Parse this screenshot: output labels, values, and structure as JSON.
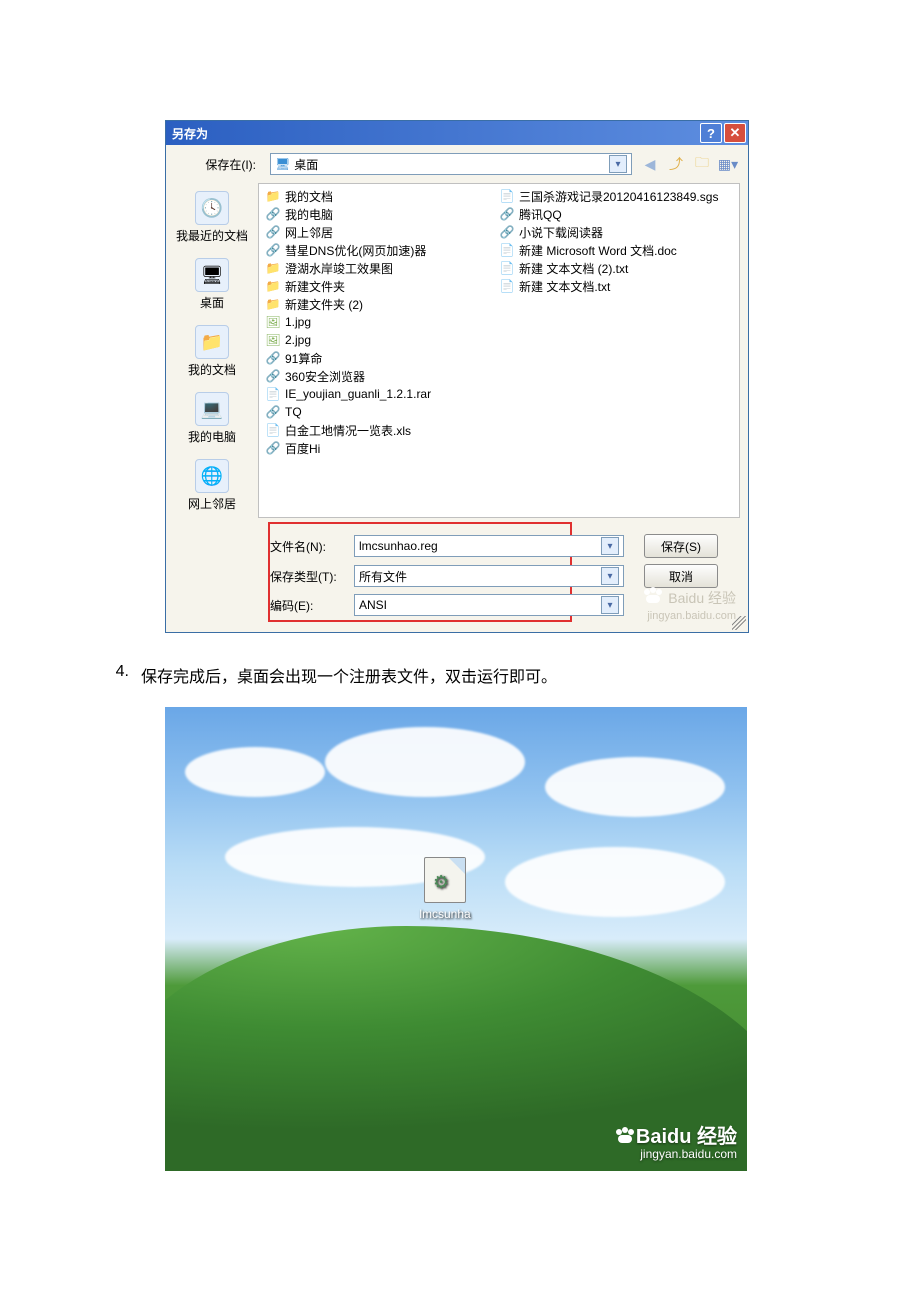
{
  "dialog": {
    "title": "另存为",
    "saveIn_label": "保存在(I):",
    "location": "桌面",
    "places": [
      {
        "label": "我最近的文档",
        "glyph": "🕓"
      },
      {
        "label": "桌面",
        "glyph": "🖥"
      },
      {
        "label": "我的文档",
        "glyph": "📁"
      },
      {
        "label": "我的电脑",
        "glyph": "💻"
      },
      {
        "label": "网上邻居",
        "glyph": "🌐"
      }
    ],
    "files_col1": [
      {
        "name": "我的文档",
        "kind": "folder"
      },
      {
        "name": "我的电脑",
        "kind": "exe"
      },
      {
        "name": "网上邻居",
        "kind": "exe"
      },
      {
        "name": "彗星DNS优化(网页加速)器",
        "kind": "exe"
      },
      {
        "name": "澄湖水岸竣工效果图",
        "kind": "folder"
      },
      {
        "name": "新建文件夹",
        "kind": "folder"
      },
      {
        "name": "新建文件夹 (2)",
        "kind": "folder"
      },
      {
        "name": "1.jpg",
        "kind": "img"
      },
      {
        "name": "2.jpg",
        "kind": "img"
      },
      {
        "name": "91算命",
        "kind": "exe"
      },
      {
        "name": "360安全浏览器",
        "kind": "exe"
      },
      {
        "name": "IE_youjian_guanli_1.2.1.rar",
        "kind": "doc"
      },
      {
        "name": "TQ",
        "kind": "exe"
      },
      {
        "name": "白金工地情况一览表.xls",
        "kind": "doc"
      },
      {
        "name": "百度Hi",
        "kind": "exe"
      }
    ],
    "files_col2": [
      {
        "name": "三国杀游戏记录20120416123849.sgs",
        "kind": "doc"
      },
      {
        "name": "腾讯QQ",
        "kind": "exe"
      },
      {
        "name": "小说下载阅读器",
        "kind": "exe"
      },
      {
        "name": "新建 Microsoft Word 文档.doc",
        "kind": "doc"
      },
      {
        "name": "新建 文本文档 (2).txt",
        "kind": "txt"
      },
      {
        "name": "新建 文本文档.txt",
        "kind": "txt"
      }
    ],
    "filename_label": "文件名(N):",
    "filename_value": "lmcsunhao.reg",
    "filetype_label": "保存类型(T):",
    "filetype_value": "所有文件",
    "encoding_label": "编码(E):",
    "encoding_value": "ANSI",
    "save_button": "保存(S)",
    "cancel_button": "取消",
    "watermark_line1": "Baidu 经验",
    "watermark_line2": "jingyan.baidu.com"
  },
  "step": {
    "number": "4.",
    "text": "保存完成后，桌面会出现一个注册表文件，双击运行即可。"
  },
  "desktop": {
    "icon_label": "lmcsunha",
    "watermark_brand": "Baidu 经验",
    "watermark_url": "jingyan.baidu.com"
  }
}
